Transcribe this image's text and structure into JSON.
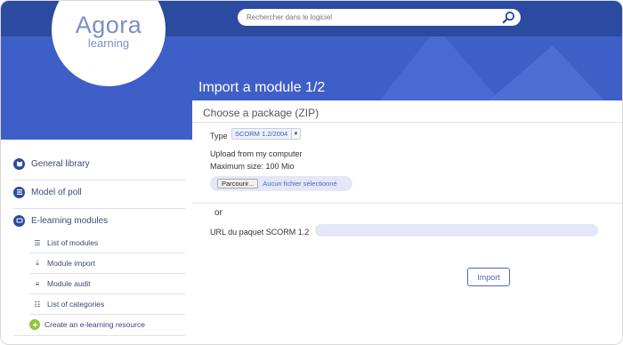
{
  "logo": {
    "main": "Agora",
    "sub": "learning"
  },
  "search": {
    "placeholder": "Rechercher dans le logiciel"
  },
  "page": {
    "title": "Import a module 1/2"
  },
  "sidebar": {
    "items": [
      {
        "label": "General library",
        "icon": "book-icon"
      },
      {
        "label": "Model of poll",
        "icon": "list-icon"
      },
      {
        "label": "E-learning modules",
        "icon": "elearning-icon"
      }
    ],
    "subitems": [
      {
        "label": "List of modules",
        "icon": "list-numbered-icon"
      },
      {
        "label": "Module import",
        "icon": "import-icon"
      },
      {
        "label": "Module audit",
        "icon": "audit-icon"
      },
      {
        "label": "List of categories",
        "icon": "categories-icon"
      }
    ],
    "create": {
      "label": "Create an e-learning resource",
      "icon": "plus-circle-icon"
    }
  },
  "form": {
    "section_title": "Choose a package (ZIP)",
    "type_label": "Type",
    "type_value": "SCORM 1.2/2004",
    "upload_label": "Upload from my computer",
    "max_size": "Maximum size: 100  Mio",
    "browse_label": "Parcourir...",
    "file_status": "Aucun fichier sélectionné",
    "or_label": "or",
    "url_label": "URL du paquet SCORM 1.2",
    "url_value": "",
    "import_label": "Import"
  },
  "colors": {
    "topbar": "#2b4ba0",
    "banner": "#3f5fc8",
    "accent": "#4a68c0",
    "create_icon": "#8cc63f"
  }
}
